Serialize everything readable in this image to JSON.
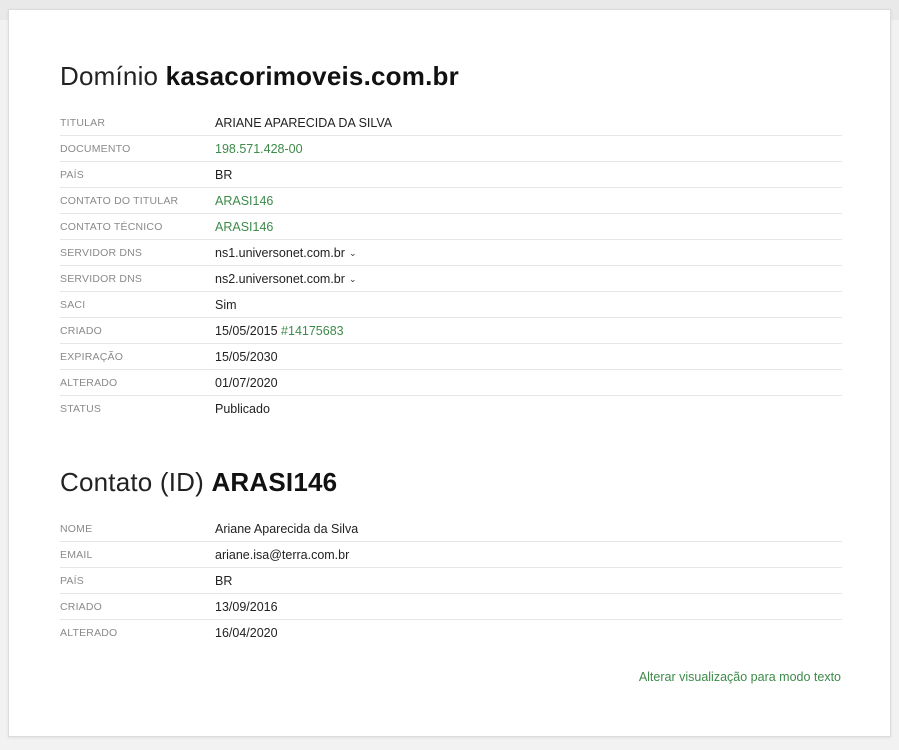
{
  "domain_section": {
    "title_prefix": "Domínio",
    "title_value": "kasacorimoveis.com.br",
    "rows": [
      {
        "label": "TITULAR",
        "value": "ARIANE APARECIDA DA SILVA",
        "link": false
      },
      {
        "label": "DOCUMENTO",
        "value": "198.571.428-00",
        "link": true
      },
      {
        "label": "PAÍS",
        "value": "BR",
        "link": false
      },
      {
        "label": "CONTATO DO TITULAR",
        "value": "ARASI146",
        "link": true
      },
      {
        "label": "CONTATO TÉCNICO",
        "value": "ARASI146",
        "link": true
      },
      {
        "label": "SERVIDOR DNS",
        "value": "ns1.universonet.com.br",
        "link": false
      },
      {
        "label": "SERVIDOR DNS",
        "value": "ns2.universonet.com.br",
        "link": false
      },
      {
        "label": "SACI",
        "value": "Sim",
        "link": false
      },
      {
        "label": "CRIADO",
        "value": "15/05/2015",
        "extra": "#14175683",
        "link": false
      },
      {
        "label": "EXPIRAÇÃO",
        "value": "15/05/2030",
        "link": false
      },
      {
        "label": "ALTERADO",
        "value": "01/07/2020",
        "link": false
      },
      {
        "label": "STATUS",
        "value": "Publicado",
        "link": false
      }
    ]
  },
  "contact_section": {
    "title_prefix": "Contato (ID)",
    "title_value": "ARASI146",
    "rows": [
      {
        "label": "NOME",
        "value": "Ariane Aparecida da Silva"
      },
      {
        "label": "EMAIL",
        "value": "ariane.isa@terra.com.br"
      },
      {
        "label": "PAÍS",
        "value": "BR"
      },
      {
        "label": "CRIADO",
        "value": "13/09/2016"
      },
      {
        "label": "ALTERADO",
        "value": "16/04/2020"
      }
    ]
  },
  "footer": {
    "toggle_text_mode": "Alterar visualização para modo texto"
  },
  "colors": {
    "link": "#3d8a4a",
    "label": "#8a8a8a",
    "divider": "#e6e6e6"
  },
  "icons": {
    "dns_expand": "chevron-down-icon"
  }
}
